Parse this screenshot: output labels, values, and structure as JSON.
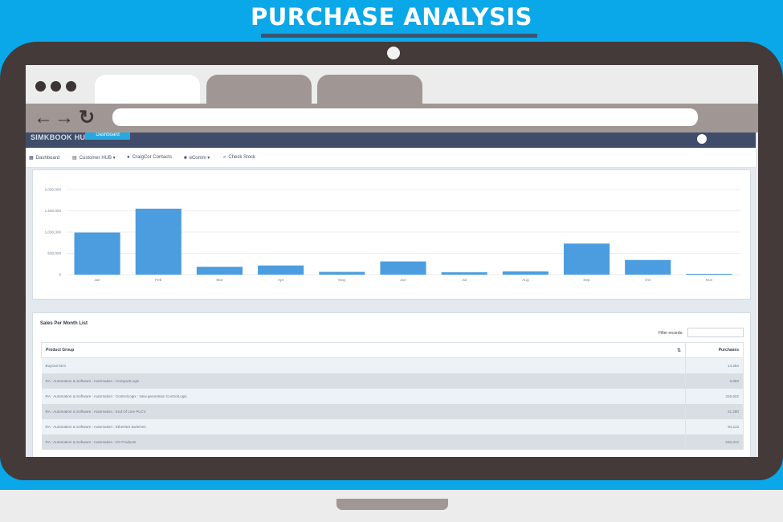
{
  "headline": "PURCHASE ANALYSIS",
  "app": {
    "logo": "SIMKBOOK HUB",
    "header_button": "Dashboard"
  },
  "menu": [
    {
      "label": "Dashboard",
      "icon": "grid-icon"
    },
    {
      "label": "Customer HUB",
      "icon": "table-icon"
    },
    {
      "label": "CraigCor Contacts",
      "icon": "contact-icon"
    },
    {
      "label": "eComm",
      "icon": "cart-icon"
    },
    {
      "label": "Check Stock",
      "icon": "search-icon"
    }
  ],
  "chart_data": {
    "type": "bar",
    "categories": [
      "Jan",
      "Feb",
      "Mar",
      "Apr",
      "May",
      "Jun",
      "Jul",
      "Aug",
      "Sep",
      "Oct",
      "Nov"
    ],
    "values": [
      990000,
      1550000,
      185000,
      215000,
      65000,
      310000,
      55000,
      75000,
      730000,
      345000,
      20000
    ],
    "yticks": [
      "0",
      "500,000",
      "1,000,000",
      "1,500,000",
      "2,000,000"
    ],
    "ylim": [
      0,
      2000000
    ],
    "color": "#4b9ddf",
    "grid": true
  },
  "table": {
    "title": "Sales Per Month List",
    "filter_label": "Filter records:",
    "filter_value": "",
    "columns": [
      "Product Group",
      "Purchases"
    ],
    "rows": [
      [
        "BuyOut Item",
        "14,284"
      ],
      [
        "RA : Automation & Software : Automation : CompactLogix",
        "3,880"
      ],
      [
        "RA : Automation & Software : Automation : ControlLogix : New generation ControlLogix",
        "316,622"
      ],
      [
        "RA : Automation & Software : Automation : End Of Line PLC's",
        "21,280"
      ],
      [
        "RA : Automation & Software : Automation : EtherNet Switches",
        "94,113"
      ],
      [
        "RA : Automation & Software : Automation : I/O Products",
        "633,312"
      ]
    ]
  }
}
